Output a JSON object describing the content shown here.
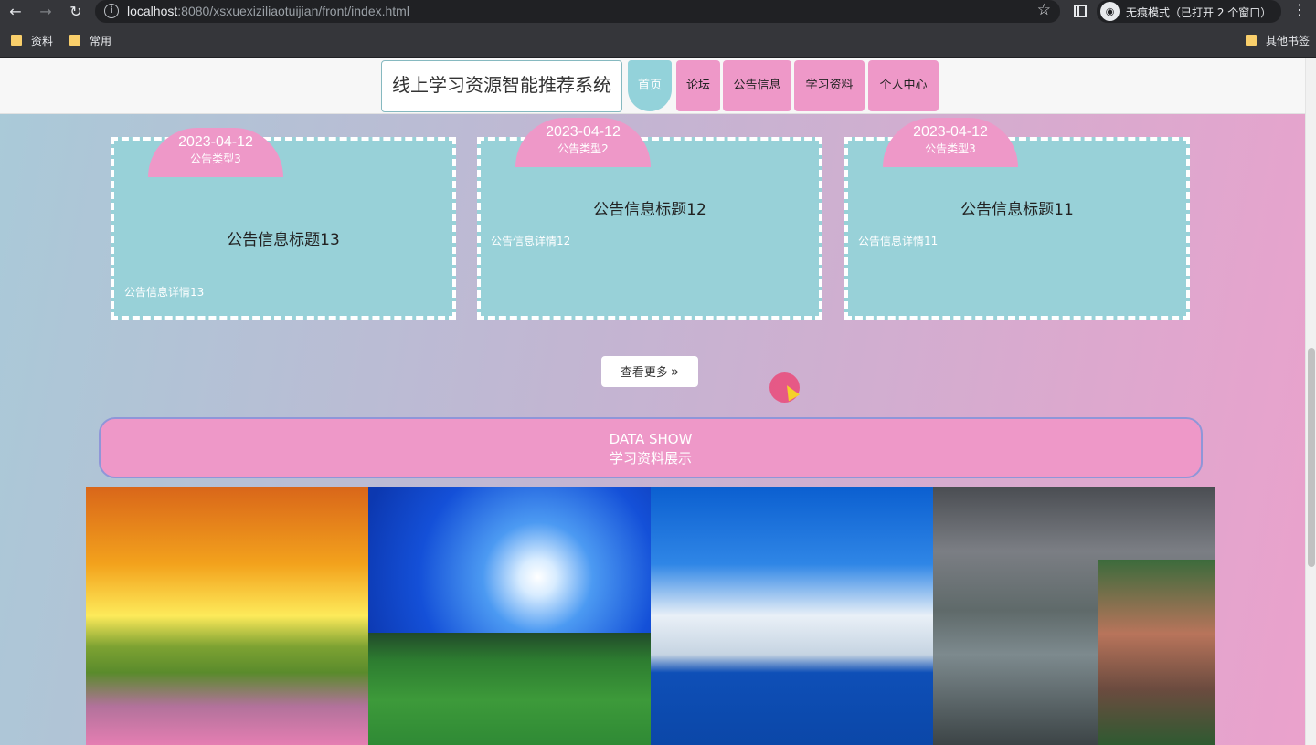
{
  "browser": {
    "url_host": "localhost",
    "url_rest": ":8080/xsxuexiziliaotuijian/front/index.html",
    "incognito_label": "无痕模式（已打开 2 个窗口）",
    "bookmarks": [
      "资料",
      "常用"
    ],
    "other_bookmarks": "其他书签"
  },
  "header": {
    "site_title": "线上学习资源智能推荐系统",
    "nav": [
      "首页",
      "论坛",
      "公告信息",
      "学习资料",
      "个人中心"
    ],
    "active_nav": "首页"
  },
  "notices": [
    {
      "date": "2023-04-12",
      "type": "公告类型3",
      "title": "公告信息标题13",
      "detail": "公告信息详情13"
    },
    {
      "date": "2023-04-12",
      "type": "公告类型2",
      "title": "公告信息标题12",
      "detail": "公告信息详情12"
    },
    {
      "date": "2023-04-12",
      "type": "公告类型3",
      "title": "公告信息标题11",
      "detail": "公告信息详情11"
    }
  ],
  "more_button": "查看更多",
  "data_show": {
    "en": "DATA SHOW",
    "cn": "学习资料展示"
  },
  "gallery": [
    "sunset-flower-field",
    "blue-sky-meadow",
    "snow-mountain-lake",
    "lakeside-town"
  ],
  "colors": {
    "card": "#98d1d8",
    "pink": "#ee98c8",
    "active_nav": "#93d2da"
  }
}
